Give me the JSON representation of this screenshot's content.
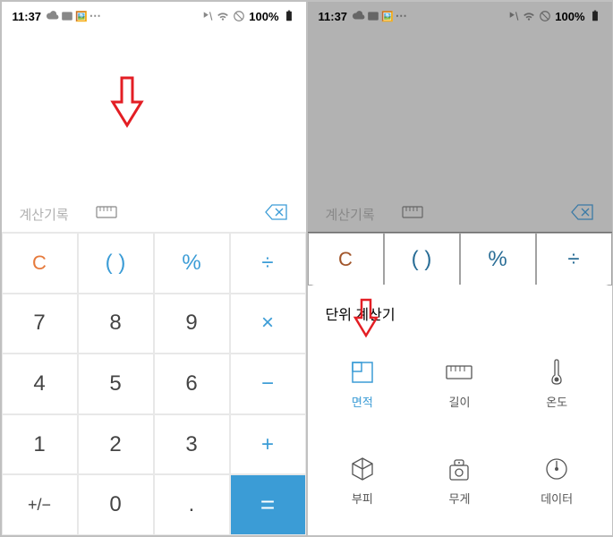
{
  "status": {
    "time": "11:37",
    "battery": "100%"
  },
  "toolbar": {
    "history_label": "계산기록"
  },
  "keypad": {
    "clear": "C",
    "paren": "( )",
    "percent": "%",
    "divide": "÷",
    "k7": "7",
    "k8": "8",
    "k9": "9",
    "multiply": "×",
    "k4": "4",
    "k5": "5",
    "k6": "6",
    "minus": "−",
    "k1": "1",
    "k2": "2",
    "k3": "3",
    "plus": "+",
    "plusminus": "+/−",
    "k0": "0",
    "dot": ".",
    "equals": "="
  },
  "sheet": {
    "title": "단위 계산기",
    "items": {
      "area": "면적",
      "length": "길이",
      "temperature": "온도",
      "volume": "부피",
      "weight": "무게",
      "data": "데이터"
    }
  }
}
